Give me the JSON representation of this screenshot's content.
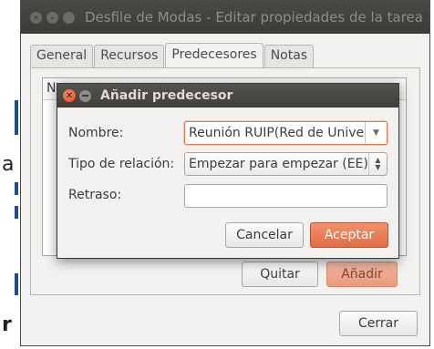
{
  "background": {
    "char_a": "a",
    "char_r": "r"
  },
  "main_window": {
    "title": "Desfile de Modas - Editar propiedades de la tarea",
    "tabs": [
      {
        "label": "General"
      },
      {
        "label": "Recursos"
      },
      {
        "label": "Predecesores",
        "active": true
      },
      {
        "label": "Notas"
      }
    ],
    "list_header_label": "N",
    "remove_label": "Quitar",
    "add_label": "Añadir",
    "close_label": "Cerrar"
  },
  "dialog": {
    "title": "Añadir predecesor",
    "name_label": "Nombre:",
    "name_value": "Reunión RUIP(Red de Univer",
    "relation_label": "Tipo de relación:",
    "relation_value": "Empezar para empezar (EE)",
    "delay_label": "Retraso:",
    "delay_value": "",
    "cancel_label": "Cancelar",
    "accept_label": "Aceptar"
  },
  "colors": {
    "accent": "#e06d45",
    "titlebar": "#3c3b37",
    "window_bg": "#f2f1f0"
  }
}
